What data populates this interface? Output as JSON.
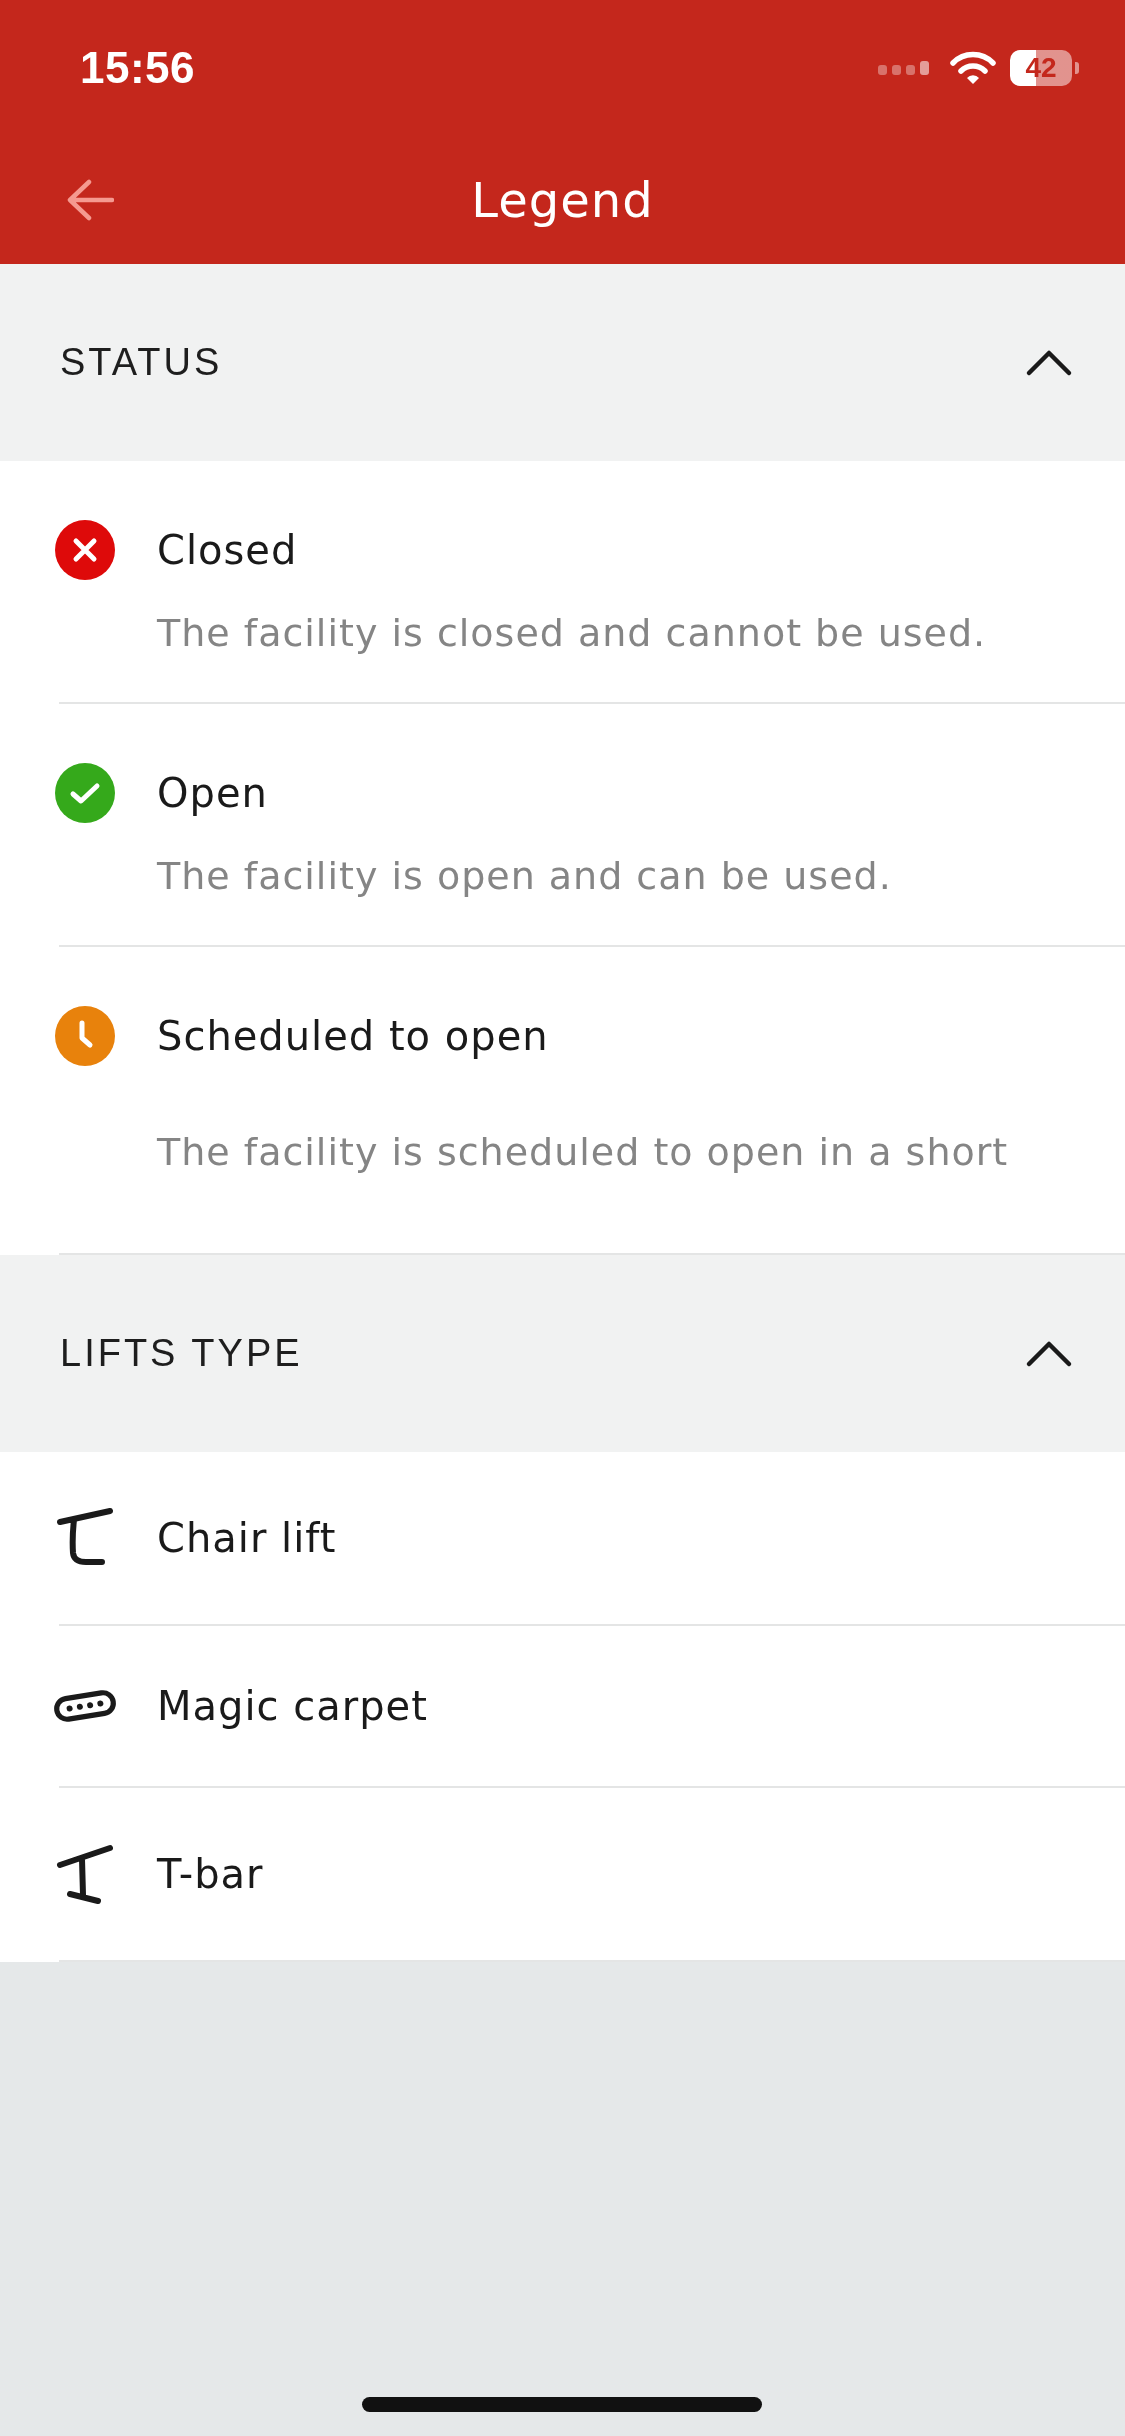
{
  "status_bar": {
    "time": "15:56",
    "battery": "42"
  },
  "header": {
    "title": "Legend"
  },
  "sections": [
    {
      "title": "STATUS",
      "expanded": true,
      "items": [
        {
          "kind": "closed",
          "color": "#de0a0a",
          "label": "Closed",
          "description": "The facility is closed and cannot be used."
        },
        {
          "kind": "open",
          "color": "#35a91b",
          "label": "Open",
          "description": "The facility is open and can be used."
        },
        {
          "kind": "scheduled",
          "color": "#e8820c",
          "label": "Scheduled to open",
          "description": "The facility is scheduled to open in a short"
        }
      ]
    },
    {
      "title": "LIFTS TYPE",
      "expanded": true,
      "items": [
        {
          "kind": "chair_lift",
          "label": "Chair lift"
        },
        {
          "kind": "magic_carpet",
          "label": "Magic carpet"
        },
        {
          "kind": "t_bar",
          "label": "T-bar"
        }
      ]
    }
  ]
}
